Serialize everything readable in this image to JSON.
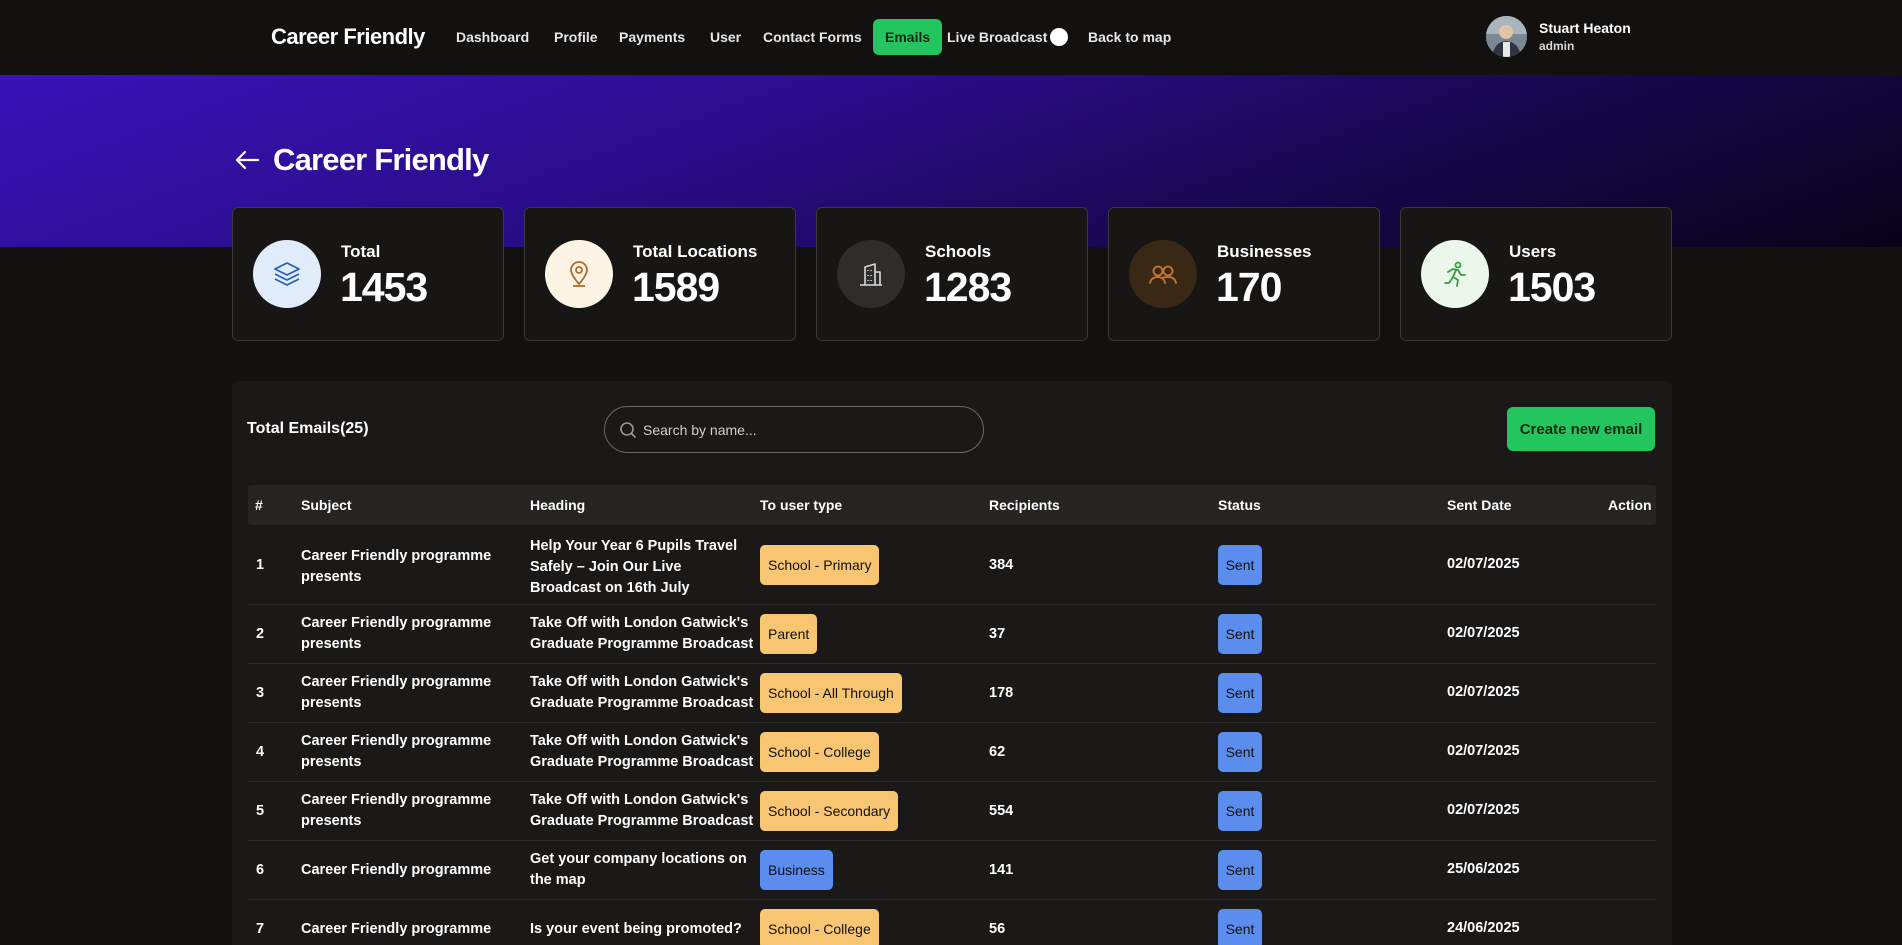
{
  "navbar": {
    "brand": "Career Friendly",
    "links": [
      "Dashboard",
      "Profile",
      "Payments",
      "User",
      "Contact Forms",
      "Emails",
      "Live Broadcast",
      "Back to map"
    ],
    "user": {
      "name": "Stuart Heaton",
      "role": "admin"
    }
  },
  "page": {
    "title": "Career Friendly"
  },
  "stats": [
    {
      "label": "Total",
      "value": "1453",
      "icon": "layers-icon"
    },
    {
      "label": "Total Locations",
      "value": "1589",
      "icon": "map-pin-icon"
    },
    {
      "label": "Schools",
      "value": "1283",
      "icon": "building-icon"
    },
    {
      "label": "Businesses",
      "value": "170",
      "icon": "users-icon"
    },
    {
      "label": "Users",
      "value": "1503",
      "icon": "runner-icon"
    }
  ],
  "emails": {
    "title": "Total Emails(25)",
    "search_placeholder": "Search by name...",
    "create_label": "Create new email",
    "columns": [
      "#",
      "Subject",
      "Heading",
      "To user type",
      "Recipients",
      "Status",
      "Sent Date",
      "Action"
    ],
    "rows": [
      {
        "num": "1",
        "subject": "Career Friendly programme presents",
        "heading": "Help Your Year 6 Pupils Travel Safely – Join Our Live Broadcast on 16th July",
        "user_type": "School - Primary",
        "recipients": "384",
        "status": "Sent",
        "date": "02/07/2025"
      },
      {
        "num": "2",
        "subject": "Career Friendly programme presents",
        "heading": "Take Off with London Gatwick's Graduate Programme Broadcast",
        "user_type": "Parent",
        "recipients": "37",
        "status": "Sent",
        "date": "02/07/2025"
      },
      {
        "num": "3",
        "subject": "Career Friendly programme presents",
        "heading": "Take Off with London Gatwick's Graduate Programme Broadcast",
        "user_type": "School - All Through",
        "recipients": "178",
        "status": "Sent",
        "date": "02/07/2025"
      },
      {
        "num": "4",
        "subject": "Career Friendly programme presents",
        "heading": "Take Off with London Gatwick's Graduate Programme Broadcast",
        "user_type": "School - College",
        "recipients": "62",
        "status": "Sent",
        "date": "02/07/2025"
      },
      {
        "num": "5",
        "subject": "Career Friendly programme presents",
        "heading": "Take Off with London Gatwick's Graduate Programme Broadcast",
        "user_type": "School - Secondary",
        "recipients": "554",
        "status": "Sent",
        "date": "02/07/2025"
      },
      {
        "num": "6",
        "subject": "Career Friendly programme",
        "heading": "Get your company locations on the map",
        "user_type": "Business",
        "recipients": "141",
        "status": "Sent",
        "date": "25/06/2025"
      },
      {
        "num": "7",
        "subject": "Career Friendly programme",
        "heading": "Is your event being promoted?",
        "user_type": "School - College",
        "recipients": "56",
        "status": "Sent",
        "date": "24/06/2025"
      }
    ]
  },
  "colors": {
    "accent": "#22c55e",
    "badge_yellow": "#f8c572",
    "badge_blue": "#5b8def"
  }
}
